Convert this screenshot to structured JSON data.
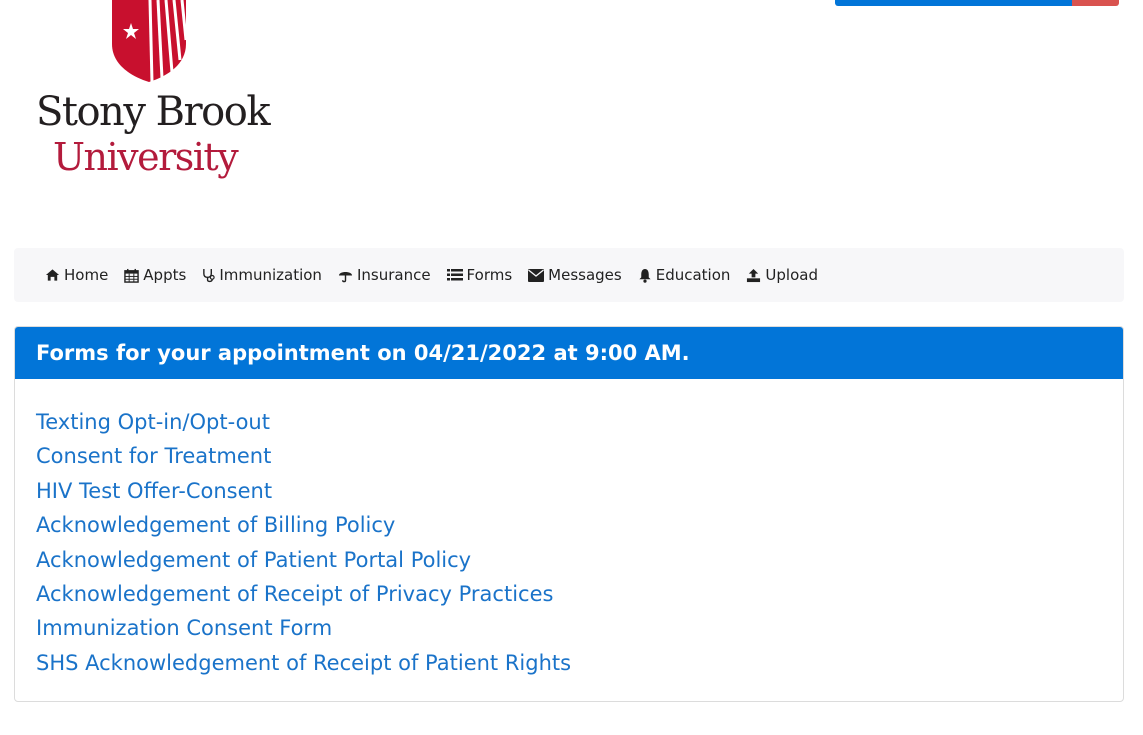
{
  "logo": {
    "line1": "Stony Brook",
    "line2": "University",
    "colors": {
      "shield": "#c8102e",
      "line1": "#231f20",
      "line2": "#b31b3c"
    }
  },
  "nav": {
    "items": [
      {
        "label": "Home",
        "icon": "home-icon"
      },
      {
        "label": "Appts",
        "icon": "calendar-icon"
      },
      {
        "label": "Immunization",
        "icon": "stethoscope-icon"
      },
      {
        "label": "Insurance",
        "icon": "umbrella-icon"
      },
      {
        "label": "Forms",
        "icon": "list-icon"
      },
      {
        "label": "Messages",
        "icon": "envelope-icon"
      },
      {
        "label": "Education",
        "icon": "bell-icon"
      },
      {
        "label": "Upload",
        "icon": "upload-icon"
      }
    ]
  },
  "card": {
    "header": "Forms for your appointment on 04/21/2022 at 9:00 AM.",
    "forms": [
      "Texting Opt-in/Opt-out",
      "Consent for Treatment",
      "HIV Test Offer-Consent",
      "Acknowledgement of Billing Policy",
      "Acknowledgement of Patient Portal Policy",
      "Acknowledgement of Receipt of Privacy Practices",
      "Immunization Consent Form",
      "SHS Acknowledgement of Receipt of Patient Rights"
    ]
  },
  "colors": {
    "primary": "#0275d8",
    "danger": "#d9534f",
    "link": "#1a73c9",
    "navbar_bg": "#f7f7f9"
  }
}
